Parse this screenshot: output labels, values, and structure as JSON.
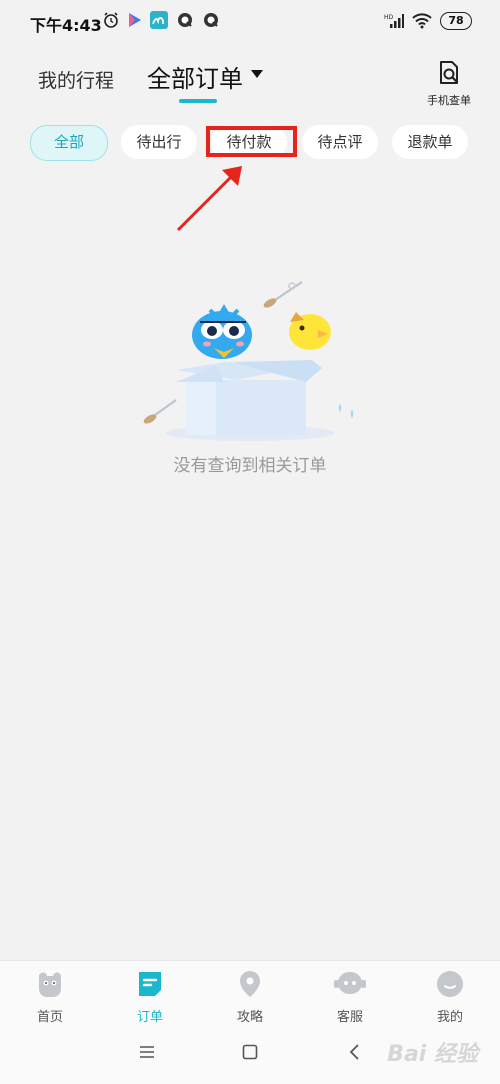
{
  "status_bar": {
    "time": "下午4:43",
    "battery": "78"
  },
  "header": {
    "tab_trips": "我的行程",
    "tab_all_orders": "全部订单",
    "phone_query_label": "手机查单"
  },
  "filters": [
    {
      "label": "全部",
      "active": true
    },
    {
      "label": "待出行",
      "active": false
    },
    {
      "label": "待付款",
      "active": false
    },
    {
      "label": "待点评",
      "active": false
    },
    {
      "label": "退款单",
      "active": false
    }
  ],
  "empty_state": {
    "message": "没有查询到相关订单"
  },
  "tab_bar": [
    {
      "label": "首页",
      "icon": "home-icon",
      "active": false
    },
    {
      "label": "订单",
      "icon": "orders-icon",
      "active": true
    },
    {
      "label": "攻略",
      "icon": "location-pin-icon",
      "active": false
    },
    {
      "label": "客服",
      "icon": "customer-service-icon",
      "active": false
    },
    {
      "label": "我的",
      "icon": "profile-icon",
      "active": false
    }
  ],
  "watermark": "Bai 经验",
  "colors": {
    "accent": "#19b8cf",
    "highlight": "#e8231b",
    "background": "#f2f2f2"
  }
}
